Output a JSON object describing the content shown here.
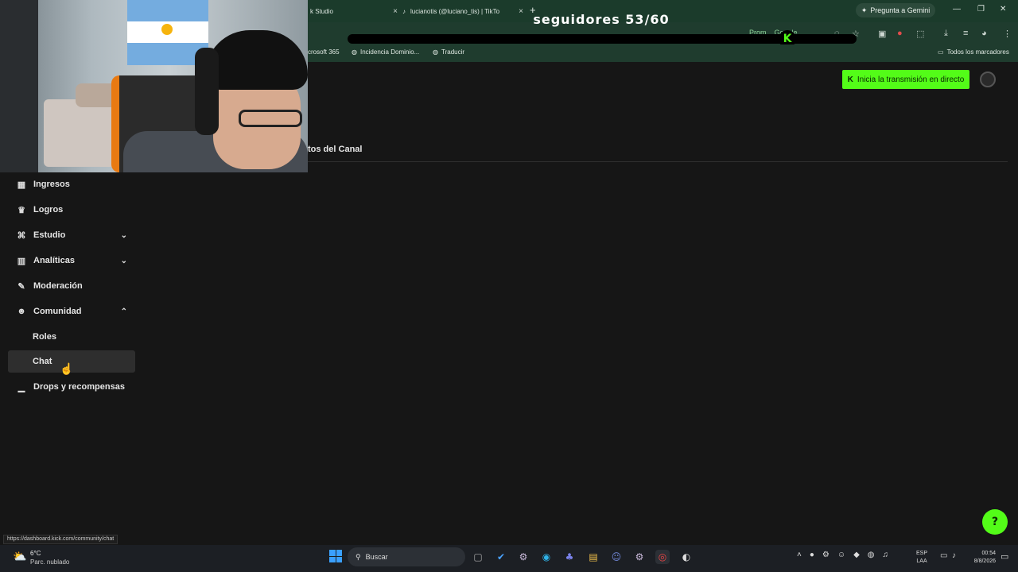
{
  "browser": {
    "tabs": [
      {
        "label": "k Studio",
        "close": "×"
      },
      {
        "label": "lucianotis (@luciano_tis) | TikTo",
        "close": "×"
      }
    ],
    "new_tab": "+",
    "gemini_button": "Pregunta a Gemini",
    "address_partial": "Prom...  Google",
    "bookmarks": [
      {
        "label": "crosoft 365"
      },
      {
        "label": "Incidencia Dominio..."
      },
      {
        "label": "Traducir"
      }
    ],
    "all_bookmarks": "Todos los marcadores",
    "status_url": "https://dashboard.kick.com/community/chat"
  },
  "overlay": {
    "followers_label": "seguidores 53/60",
    "goal_current": 53,
    "goal_target": 60,
    "progress_icon": "K"
  },
  "header": {
    "live_button": "Inicia la transmisión en directo",
    "live_icon": "K"
  },
  "section": {
    "title": "tos del Canal"
  },
  "sidebar": {
    "items": [
      {
        "label": "Ingresos",
        "icon": "revenue-icon",
        "glyph": "▦"
      },
      {
        "label": "Logros",
        "icon": "trophy-icon",
        "glyph": "♛"
      },
      {
        "label": "Estudio",
        "icon": "studio-icon",
        "glyph": "⌘",
        "chevron": "⌄"
      },
      {
        "label": "Analíticas",
        "icon": "analytics-icon",
        "glyph": "▥",
        "chevron": "⌄"
      },
      {
        "label": "Moderación",
        "icon": "wrench-icon",
        "glyph": "✎"
      },
      {
        "label": "Comunidad",
        "icon": "community-icon",
        "glyph": "☻",
        "chevron": "⌃"
      },
      {
        "label": "Roles"
      },
      {
        "label": "Chat"
      },
      {
        "label": "Drops y recompensas",
        "icon": "drops-icon",
        "glyph": "▁"
      }
    ]
  },
  "help_icon": "?",
  "taskbar": {
    "weather_temp": "6°C",
    "weather_desc": "Parc. nublado",
    "search_placeholder": "Buscar",
    "lang_top": "ESP",
    "lang_bottom": "LAA",
    "time": "00:54",
    "date": "8/8/2026"
  },
  "colors": {
    "accent": "#53fc18",
    "chrome": "#1b3b2b",
    "background": "#161616"
  }
}
